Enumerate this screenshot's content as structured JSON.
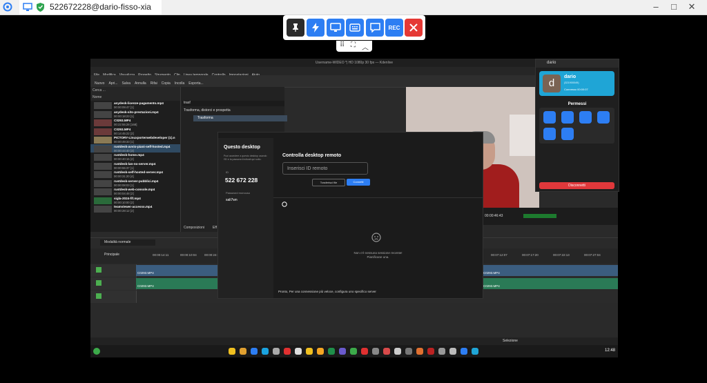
{
  "outer": {
    "tab_title": "522672228@dario-fisso-xia",
    "min_glyph": "–",
    "max_glyph": "□",
    "close_glyph": "✕"
  },
  "toolbar": {
    "rec_label": "REC"
  },
  "kdenlive": {
    "window_title": "Username-WIDEO *| HD 1080p 30 fps — Kdenlive",
    "menu": [
      "File",
      "Modifica",
      "Visualizza",
      "Progetto",
      "Strumento",
      "Clip",
      "Linea temporale",
      "Controllo",
      "Impostazioni",
      "Aiuto"
    ],
    "tools": [
      "Nuovo",
      "Apri...",
      "Salva",
      "Annulla",
      "Rifai",
      "Copia",
      "Incolla",
      "Esporta..."
    ],
    "bin_search_placeholder": "Cerca ...",
    "bin_header": "Nome",
    "clips": [
      {
        "name": "anydesk-licenze-pagamento.mp4",
        "dur": "00:00:09:47 [1]"
      },
      {
        "name": "anydesk-sito-prestazioni.mp4",
        "dur": "00:00:18:23 [1]"
      },
      {
        "name": "C0293.MP4",
        "dur": "00:22:55:28 [168]"
      },
      {
        "name": "C0293.MP4",
        "dur": "00:14:45:22 [2]"
      },
      {
        "name": "PICTORY-Linuxporterwebdeveloper (1).n",
        "dur": "00:00:49:33 [1]"
      },
      {
        "name": "rustdesk-avvio-piani-self-hosted.mp4",
        "dur": "00:00:44:40 [3]"
      },
      {
        "name": "rustdesk-home.mp4",
        "dur": "00:00:40:15 [2]"
      },
      {
        "name": "rustdesk-lan-no-server.mp4",
        "dur": "00:00:55:37 [1]"
      },
      {
        "name": "rustdesk-self-hosted-server.mp4",
        "dur": "00:00:31:20 [4]"
      },
      {
        "name": "rustdesk-server-pubblici.mp4",
        "dur": "00:00:08:03 [1]"
      },
      {
        "name": "rustdesk-web-console.mp4",
        "dur": "00:00:04:48 [2]"
      },
      {
        "name": "sigla-2024-fif.mp4",
        "dur": "00:00:10:00 [2]"
      },
      {
        "name": "teamviewer-accesso.mp4",
        "dur": "00:00:28:12 [2]"
      }
    ],
    "effects_search": "trasf",
    "effects_category": "Trasforma, distorci e prospetta",
    "effects_item": "Trasforma",
    "tabs_bottom": [
      "Composizioni",
      "Eff"
    ],
    "monitor_timecode": "00:00:46:43",
    "timeline_mode": "Modalità normale",
    "timeline_label": "Principale",
    "ruler_left": [
      "00:00:14:11",
      "00:00:10:04",
      "00:00:24:06"
    ],
    "ruler_right": [
      "00:07:12:07",
      "00:07:17:20",
      "00:07:22:13",
      "00:07:27:04"
    ],
    "clip_label": "C0293.MP4",
    "bottom_label": "Selezione",
    "clock": "12:48"
  },
  "rustdesk": {
    "left_title": "Questo desktop",
    "left_desc": "Puoi accedere a questo desktop usando l'ID e la password indicati qui sotto.",
    "id_label": "ID",
    "id_value": "522 672 228",
    "pw_label": "Password monouso",
    "pw_value": "sali7wn",
    "control_title": "Controlla desktop remoto",
    "id_placeholder": "Inserisci ID remoto",
    "btn_transfer": "Trasferisci file",
    "btn_connect": "Connetti",
    "empty_line1": "Non c'è nessuna sessione recente!",
    "empty_line2": "Pianificane una.",
    "status": "Pronto, Per una connessione più veloce, configura uno specifico server"
  },
  "session": {
    "window_title": "dario",
    "avatar_letter": "d",
    "name": "dario",
    "id": "(321900049)",
    "time": "Connesso 00:00:07",
    "permissions_title": "Permessi",
    "disconnect": "Disconnetti"
  },
  "colors": {
    "accent": "#2d7ef3",
    "danger": "#e53935",
    "session_card": "#1fa5d6"
  }
}
